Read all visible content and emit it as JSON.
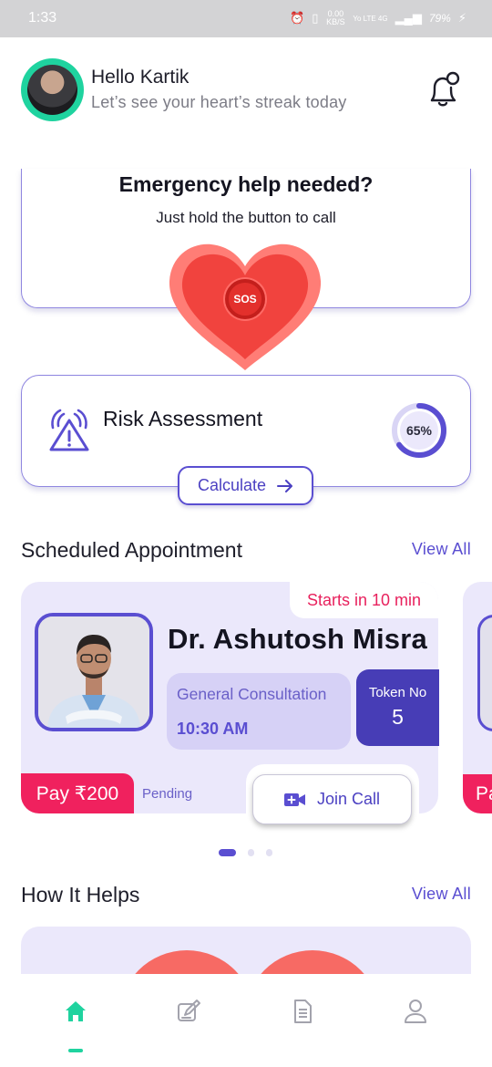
{
  "status_bar": {
    "time": "1:33",
    "net_speed": "0.00 KB/S",
    "network": "Yo LTE 4G",
    "battery": "79%"
  },
  "header": {
    "greeting": "Hello Kartik",
    "subtitle": "Let’s see your heart’s streak today"
  },
  "emergency": {
    "title": "Emergency help needed?",
    "subtitle": "Just hold the button to call",
    "sos_label": "SOS"
  },
  "risk": {
    "title": "Risk Assessment",
    "percent_label": "65%",
    "progress_fraction": 0.65,
    "calculate_label": "Calculate"
  },
  "appointments": {
    "section_title": "Scheduled Appointment",
    "view_all": "View All",
    "card": {
      "starts": "Starts in 10 min",
      "doctor": "Dr. Ashutosh Misra",
      "type": "General Consultation",
      "time": "10:30 AM",
      "token_label": "Token No",
      "token_number": "5",
      "pay": "Pay ₹200",
      "status": "Pending",
      "join": "Join Call"
    },
    "next_card_pay": "Pa",
    "pager": {
      "count": 3,
      "active": 0
    }
  },
  "how_it_helps": {
    "section_title": "How It Helps",
    "view_all": "View All"
  },
  "nav": {
    "items": [
      "home-icon",
      "edit-note-icon",
      "document-icon",
      "profile-icon"
    ],
    "active": 0
  },
  "colors": {
    "accent": "#5a4ed1",
    "teal": "#1fd39f",
    "heart": "#f0433e",
    "pink": "#f0215e",
    "card_bg": "#ebe8fb"
  }
}
